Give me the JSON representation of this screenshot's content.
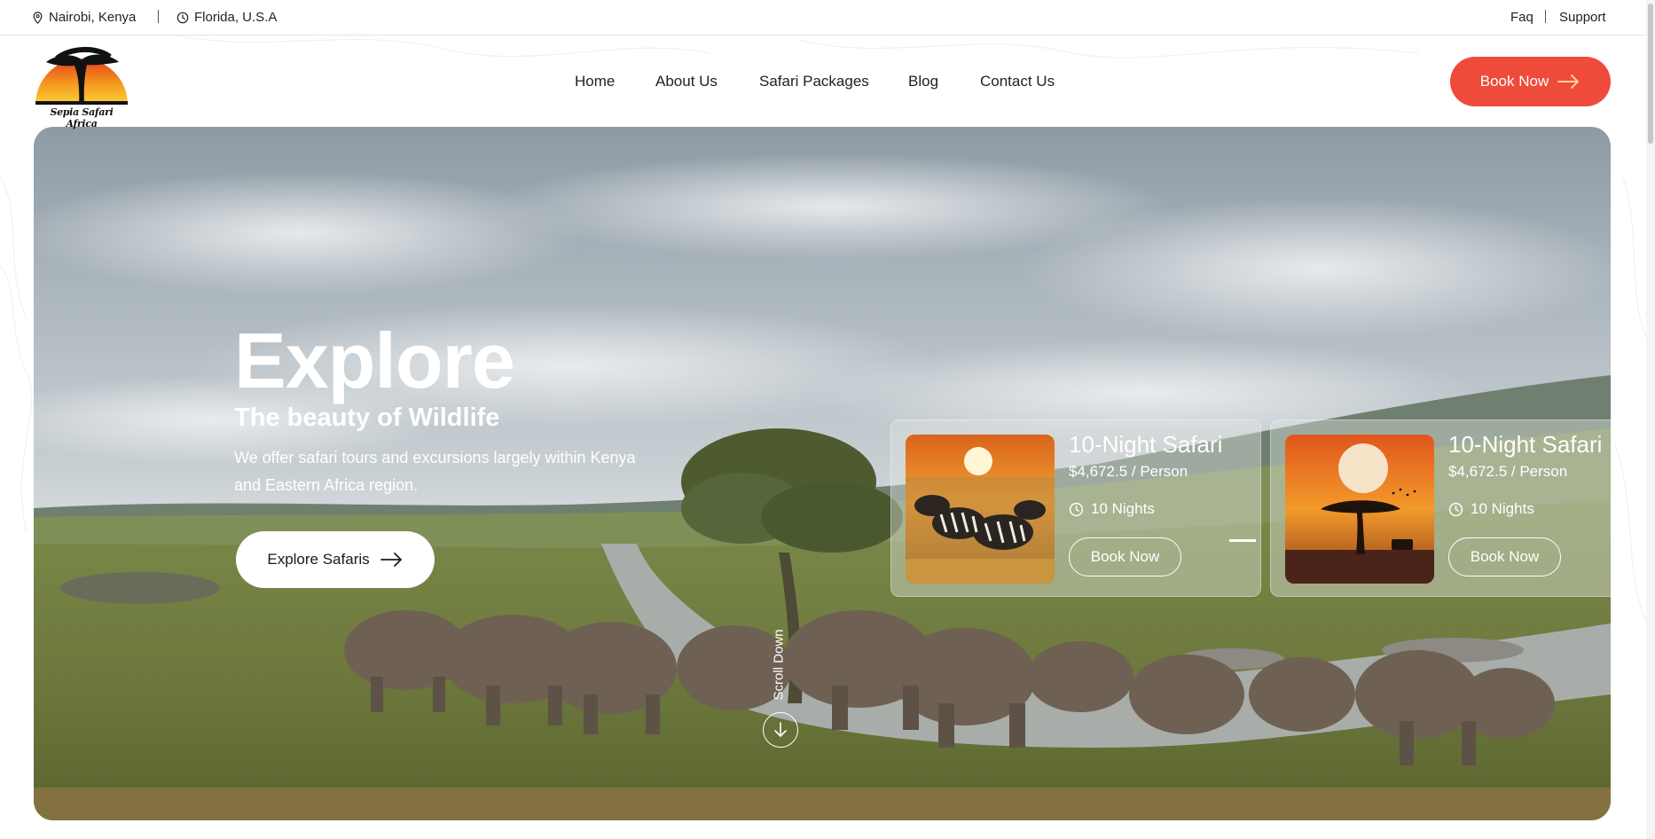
{
  "topbar": {
    "location_1": "Nairobi, Kenya",
    "location_2": "Florida, U.S.A",
    "faq": "Faq",
    "support": "Support"
  },
  "logo": {
    "text": "Sepia Safari Africa"
  },
  "nav": {
    "items": [
      "Home",
      "About Us",
      "Safari Packages",
      "Blog",
      "Contact Us"
    ],
    "book_label": "Book Now"
  },
  "hero": {
    "title": "Explore",
    "subtitle": "The beauty of Wildlife",
    "description": "We offer safari tours and excursions largely within Kenya and Eastern Africa region.",
    "cta_label": "Explore Safaris",
    "scroll_label": "Scroll Down"
  },
  "cards": [
    {
      "title": "10-Night Safari",
      "price": "$4,672.5 / Person",
      "nights": "10 Nights",
      "button": "Book Now",
      "image": "zebras-at-sunset"
    },
    {
      "title": "10-Night Safari",
      "price": "$4,672.5 / Person",
      "nights": "10 Nights",
      "button": "Book Now",
      "image": "acacia-tree-sunset"
    }
  ],
  "colors": {
    "accent": "#ee4b3a",
    "text": "#1a1a1a"
  }
}
